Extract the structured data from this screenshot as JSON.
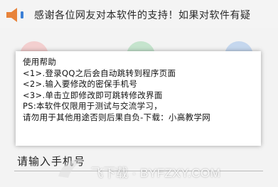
{
  "notice": {
    "icon": "speaker-icon",
    "text": "感谢各位网友对本软件的支持！如果对软件有疑"
  },
  "help_dialog": {
    "title": "使用帮助",
    "lines": [
      "<1>.登录QQ之后会自动跳转到程序页面",
      "<2>.输入要修改的密保手机号",
      "<3>.单击立即修改即可跳转修改界面",
      "PS:本软件仅限用于测试与交流学习，",
      "请勿用于其他用途否则后果自负-下载：小高教学网"
    ]
  },
  "form": {
    "phone_label": "请输入手机号"
  },
  "watermark": {
    "text": "飞下载 · BYFZXY.COM"
  },
  "colors": {
    "speaker_orange": "#e8833a",
    "speaker_blue": "#3b7fd6",
    "dialog_bg": "#ffffff"
  }
}
